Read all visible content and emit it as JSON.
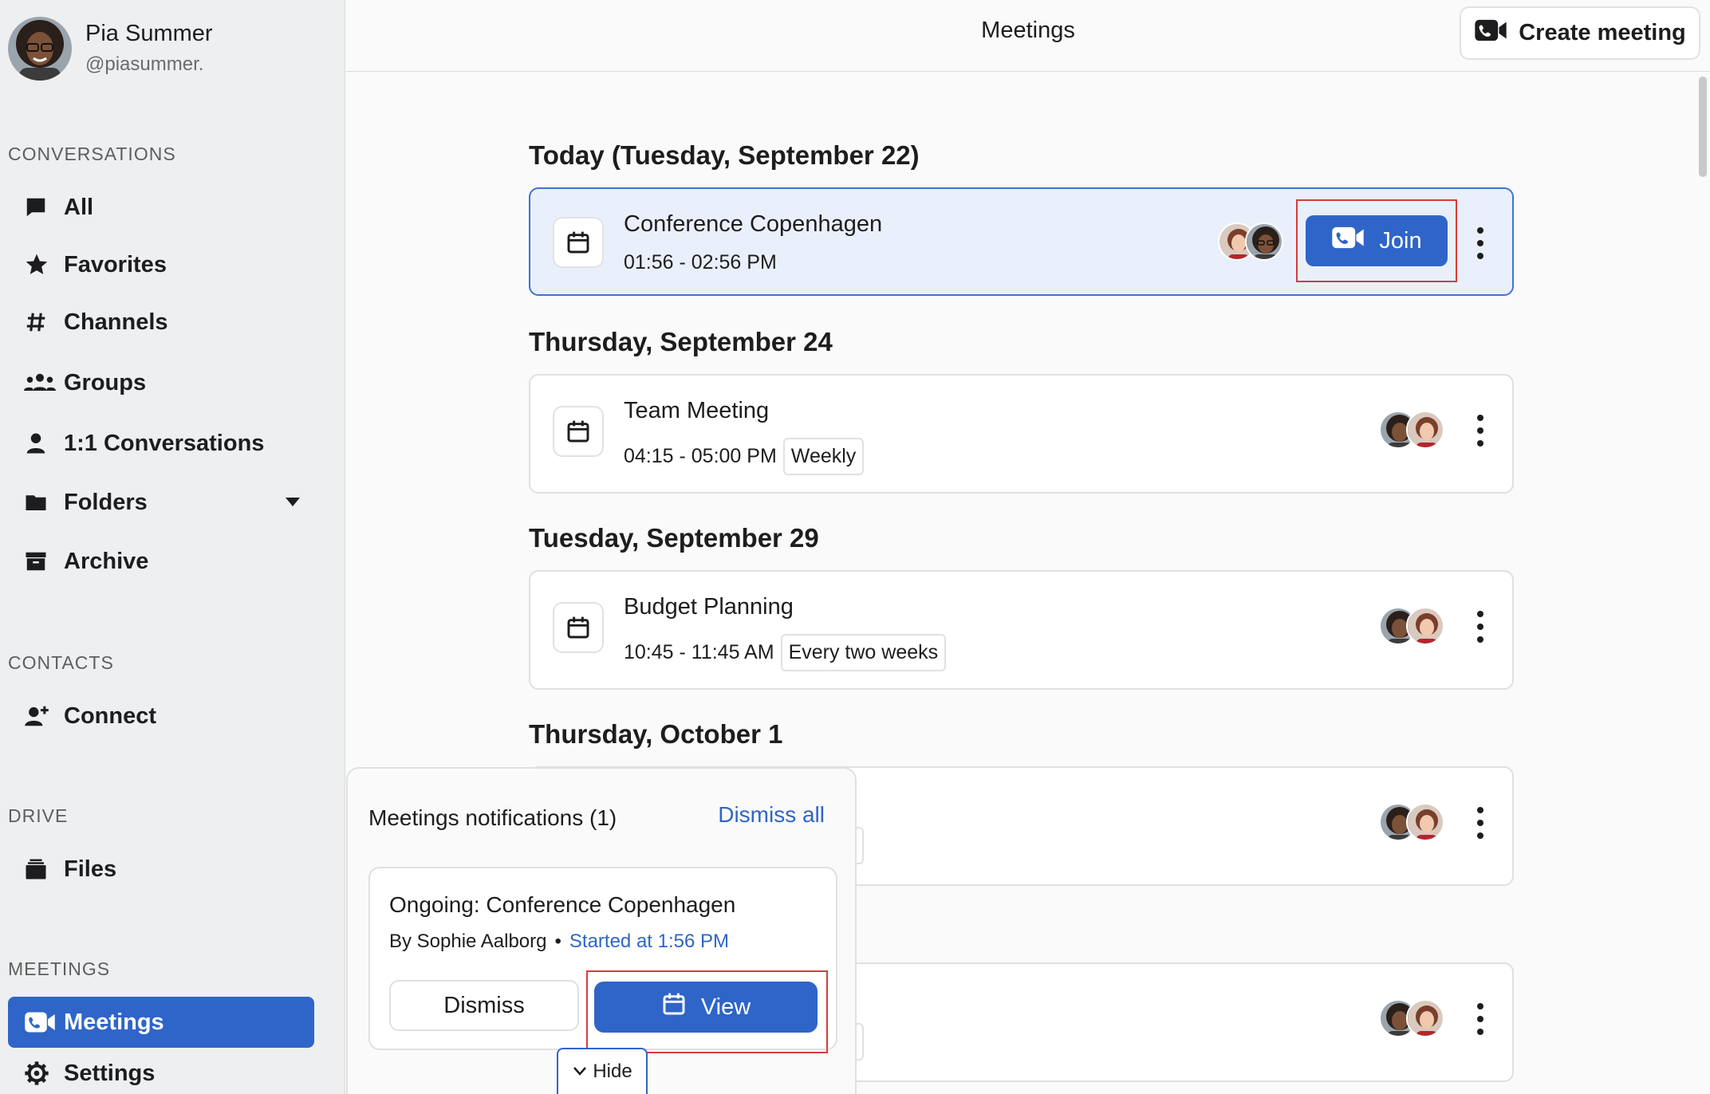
{
  "profile": {
    "name": "Pia Summer",
    "handle": "@piasummer."
  },
  "sidebar": {
    "conversations_title": "CONVERSATIONS",
    "conversations": [
      {
        "label": "All",
        "icon": "chat-bubble-icon"
      },
      {
        "label": "Favorites",
        "icon": "star-icon"
      },
      {
        "label": "Channels",
        "icon": "hash-icon"
      },
      {
        "label": "Groups",
        "icon": "group-icon"
      },
      {
        "label": "1:1 Conversations",
        "icon": "person-icon"
      },
      {
        "label": "Folders",
        "icon": "folder-icon"
      },
      {
        "label": "Archive",
        "icon": "archive-icon"
      }
    ],
    "contacts_title": "CONTACTS",
    "contacts": [
      {
        "label": "Connect",
        "icon": "add-person-icon"
      }
    ],
    "drive_title": "DRIVE",
    "drive": [
      {
        "label": "Files",
        "icon": "files-icon"
      }
    ],
    "meetings_title": "MEETINGS",
    "meetings": [
      {
        "label": "Meetings",
        "icon": "video-call-icon",
        "active": true
      },
      {
        "label": "Settings",
        "icon": "gear-icon"
      }
    ]
  },
  "header": {
    "title": "Meetings",
    "create_label": "Create meeting"
  },
  "meetings": {
    "groups": [
      {
        "heading": "Today (Tuesday, September 22)",
        "items": [
          {
            "title": "Conference Copenhagen",
            "time": "01:56 - 02:56 PM",
            "join_label": "Join"
          }
        ]
      },
      {
        "heading": "Thursday, September 24",
        "items": [
          {
            "title": "Team Meeting",
            "time": "04:15 - 05:00 PM",
            "recurrence": "Weekly"
          }
        ]
      },
      {
        "heading": "Tuesday, September 29",
        "items": [
          {
            "title": "Budget Planning",
            "time": "10:45 - 11:45 AM",
            "recurrence": "Every two weeks"
          }
        ]
      },
      {
        "heading": "Thursday, October 1",
        "items": [
          {
            "title": "",
            "time": ""
          }
        ]
      }
    ]
  },
  "notifications": {
    "title": "Meetings notifications (1)",
    "dismiss_all": "Dismiss all",
    "card": {
      "title": "Ongoing: Conference Copenhagen",
      "by": "By Sophie Aalborg",
      "separator": "•",
      "started": "Started at 1:56 PM",
      "dismiss_label": "Dismiss",
      "view_label": "View"
    },
    "hide_label": "Hide"
  },
  "colors": {
    "accent": "#2f65c8",
    "highlight_bg": "#e9f0fb",
    "annotation": "#d93a3a"
  }
}
